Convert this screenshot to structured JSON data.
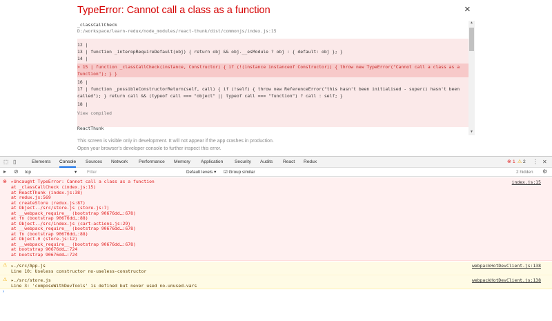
{
  "overlay": {
    "title": "TypeError: Cannot call a class as a function",
    "close_label": "×",
    "frame1_fn": "_classCallCheck",
    "frame1_file": "D:/workspace/learn-redux/node_modules/react-thunk/dist/commonjs/index.js:15",
    "code_lines": [
      {
        "text": "  12 |",
        "highlight": false
      },
      {
        "text": "  13 | function _interopRequireDefault(obj) { return obj && obj.__esModule ? obj : { default: obj }; }",
        "highlight": false
      },
      {
        "text": "  14 |",
        "highlight": false
      },
      {
        "text": "> 15 | function _classCallCheck(instance, Constructor) { if (!(instance instanceof Constructor)) { throw new TypeError(\"Cannot call a class as a",
        "highlight": true
      },
      {
        "text": "function\"); } }",
        "highlight": true
      },
      {
        "text": "  16 |",
        "highlight": false
      },
      {
        "text": "  17 | function _possibleConstructorReturn(self, call) { if (!self) { throw new ReferenceError(\"this hasn't been initialised - super() hasn't been",
        "highlight": false
      },
      {
        "text": "called\"); } return call && (typeof call === \"object\" || typeof call === \"function\") ? call : self; }",
        "highlight": false
      },
      {
        "text": "  18 |",
        "highlight": false
      }
    ],
    "view_compiled": "View compiled",
    "frame2_fn": "ReactThunk",
    "footer_line1": "This screen is visible only in development. It will not appear if the app crashes in production.",
    "footer_line2": "Open your browser’s developer console to further inspect this error."
  },
  "devtools": {
    "tabs": [
      "Elements",
      "Console",
      "Sources",
      "Network",
      "Performance",
      "Memory",
      "Application",
      "Security",
      "Audits",
      "React",
      "Redux"
    ],
    "active_tab": "Console",
    "error_count": "1",
    "warning_count": "2",
    "context": "top",
    "filter_placeholder": "Filter",
    "levels_label": "Default levels ▾",
    "group_similar_label": "Group similar",
    "hidden_label": "2 hidden",
    "error": {
      "message": "▸Uncaught TypeError: Cannot call a class as a function",
      "source": "index.js:15",
      "stack": [
        "    at _classCallCheck (index.js:15)",
        "    at ReactThunk (index.js:38)",
        "    at redux.js:569",
        "    at createStore (redux.js:87)",
        "    at Object../src/store.js (store.js:7)",
        "    at __webpack_require__ (bootstrap 90676dd…:678)",
        "    at fn (bootstrap 90676dd…:88)",
        "    at Object../src/index.js (cart-actions.js:29)",
        "    at __webpack_require__ (bootstrap 90676dd…:678)",
        "    at fn (bootstrap 90676dd…:88)",
        "    at Object.0 (store.js:12)",
        "    at __webpack_require__ (bootstrap 90676dd…:678)",
        "    at bootstrap 90676dd…:724",
        "    at bootstrap 90676dd…:724"
      ]
    },
    "warnings": [
      {
        "line1": "▸./src/App.js",
        "line2": "  Line 10:  Useless constructor  no-useless-constructor",
        "source": "webpackHotDevClient.js:138"
      },
      {
        "line1": "▸./src/store.js",
        "line2": "  Line 3:  'composeWithDevTools' is defined but never used  no-unused-vars",
        "source": "webpackHotDevClient.js:138"
      }
    ],
    "prompt": "›"
  }
}
